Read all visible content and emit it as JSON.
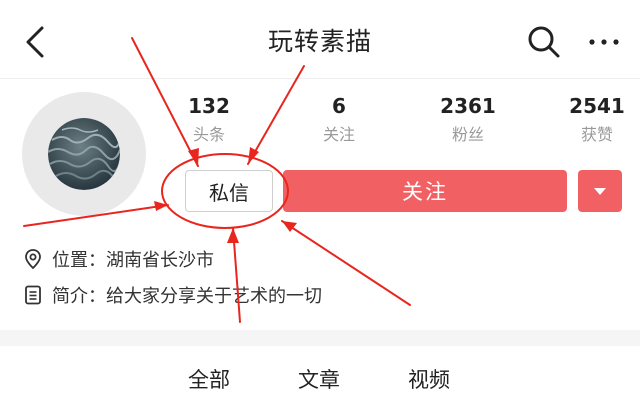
{
  "header": {
    "title": "玩转素描",
    "back_icon": "chevron-left-icon",
    "search_icon": "search-icon",
    "more_icon": "more-icon"
  },
  "profile": {
    "stats": [
      {
        "value": "132",
        "label": "头条"
      },
      {
        "value": "6",
        "label": "关注"
      },
      {
        "value": "2361",
        "label": "粉丝"
      },
      {
        "value": "2541",
        "label": "获赞"
      }
    ],
    "message_button": "私信",
    "follow_button": "关注",
    "follow_color": "#f16163",
    "location_label": "位置：",
    "location_value": "湖南省长沙市",
    "bio_label": "简介：",
    "bio_value": "给大家分享关于艺术的一切"
  },
  "tabs": [
    {
      "label": "全部"
    },
    {
      "label": "文章"
    },
    {
      "label": "视频"
    }
  ],
  "annotation": {
    "color": "#e8261e",
    "target": "message-button"
  }
}
